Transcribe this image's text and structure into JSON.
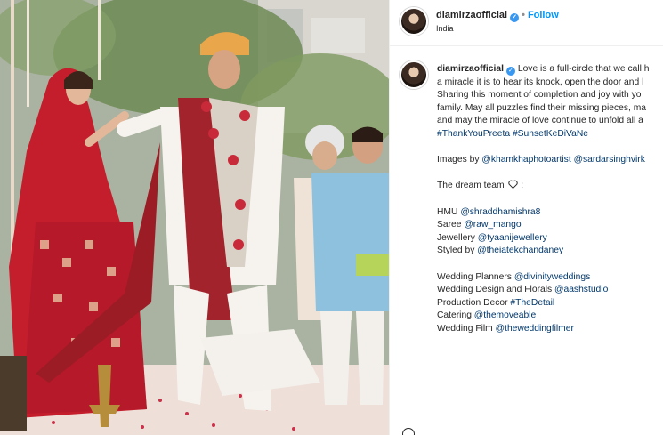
{
  "post": {
    "username": "diamirzaofficial",
    "follow_label": "Follow",
    "separator": "•",
    "location": "India",
    "verified_mark": "✓",
    "verified_icon": "verified-badge-icon"
  },
  "caption": {
    "username": "diamirzaofficial",
    "line1": "Love is a full-circle that we call h",
    "line2": "a miracle it is to hear its knock, open the door and l",
    "line3": "Sharing this moment of completion and joy with yo",
    "line4": "family. May all puzzles find their missing pieces, ma",
    "line5": "and may the miracle of love continue to unfold all a",
    "hashtags": [
      "#ThankYouPreeta",
      "#SunsetKeDiVaNe"
    ],
    "images_prefix": "Images by ",
    "images_by": [
      "@khamkhaphotoartist",
      "@sardarsinghvirk"
    ],
    "dream_team": "The dream team",
    "dream_team_suffix": " :",
    "team": [
      {
        "role": "HMU ",
        "handle": "@shraddhamishra8"
      },
      {
        "role": "Saree ",
        "handle": "@raw_mango"
      },
      {
        "role": "Jewellery ",
        "handle": "@tyaanijewellery"
      },
      {
        "role": "Styled by ",
        "handle": "@theiatekchandaney"
      }
    ],
    "vendors": [
      {
        "role": "Wedding Planners ",
        "handle": "@divinityweddings"
      },
      {
        "role": "Wedding Design and Florals ",
        "handle": "@aashstudio"
      },
      {
        "role": "Production Decor ",
        "handle": "#TheDetail"
      },
      {
        "role": "Catering ",
        "handle": "@themoveable"
      },
      {
        "role": "Wedding Film ",
        "handle": "@theweddingfilmer"
      }
    ]
  },
  "colors": {
    "link": "#00376b",
    "follow": "#0095f6",
    "verified": "#3897f0"
  }
}
